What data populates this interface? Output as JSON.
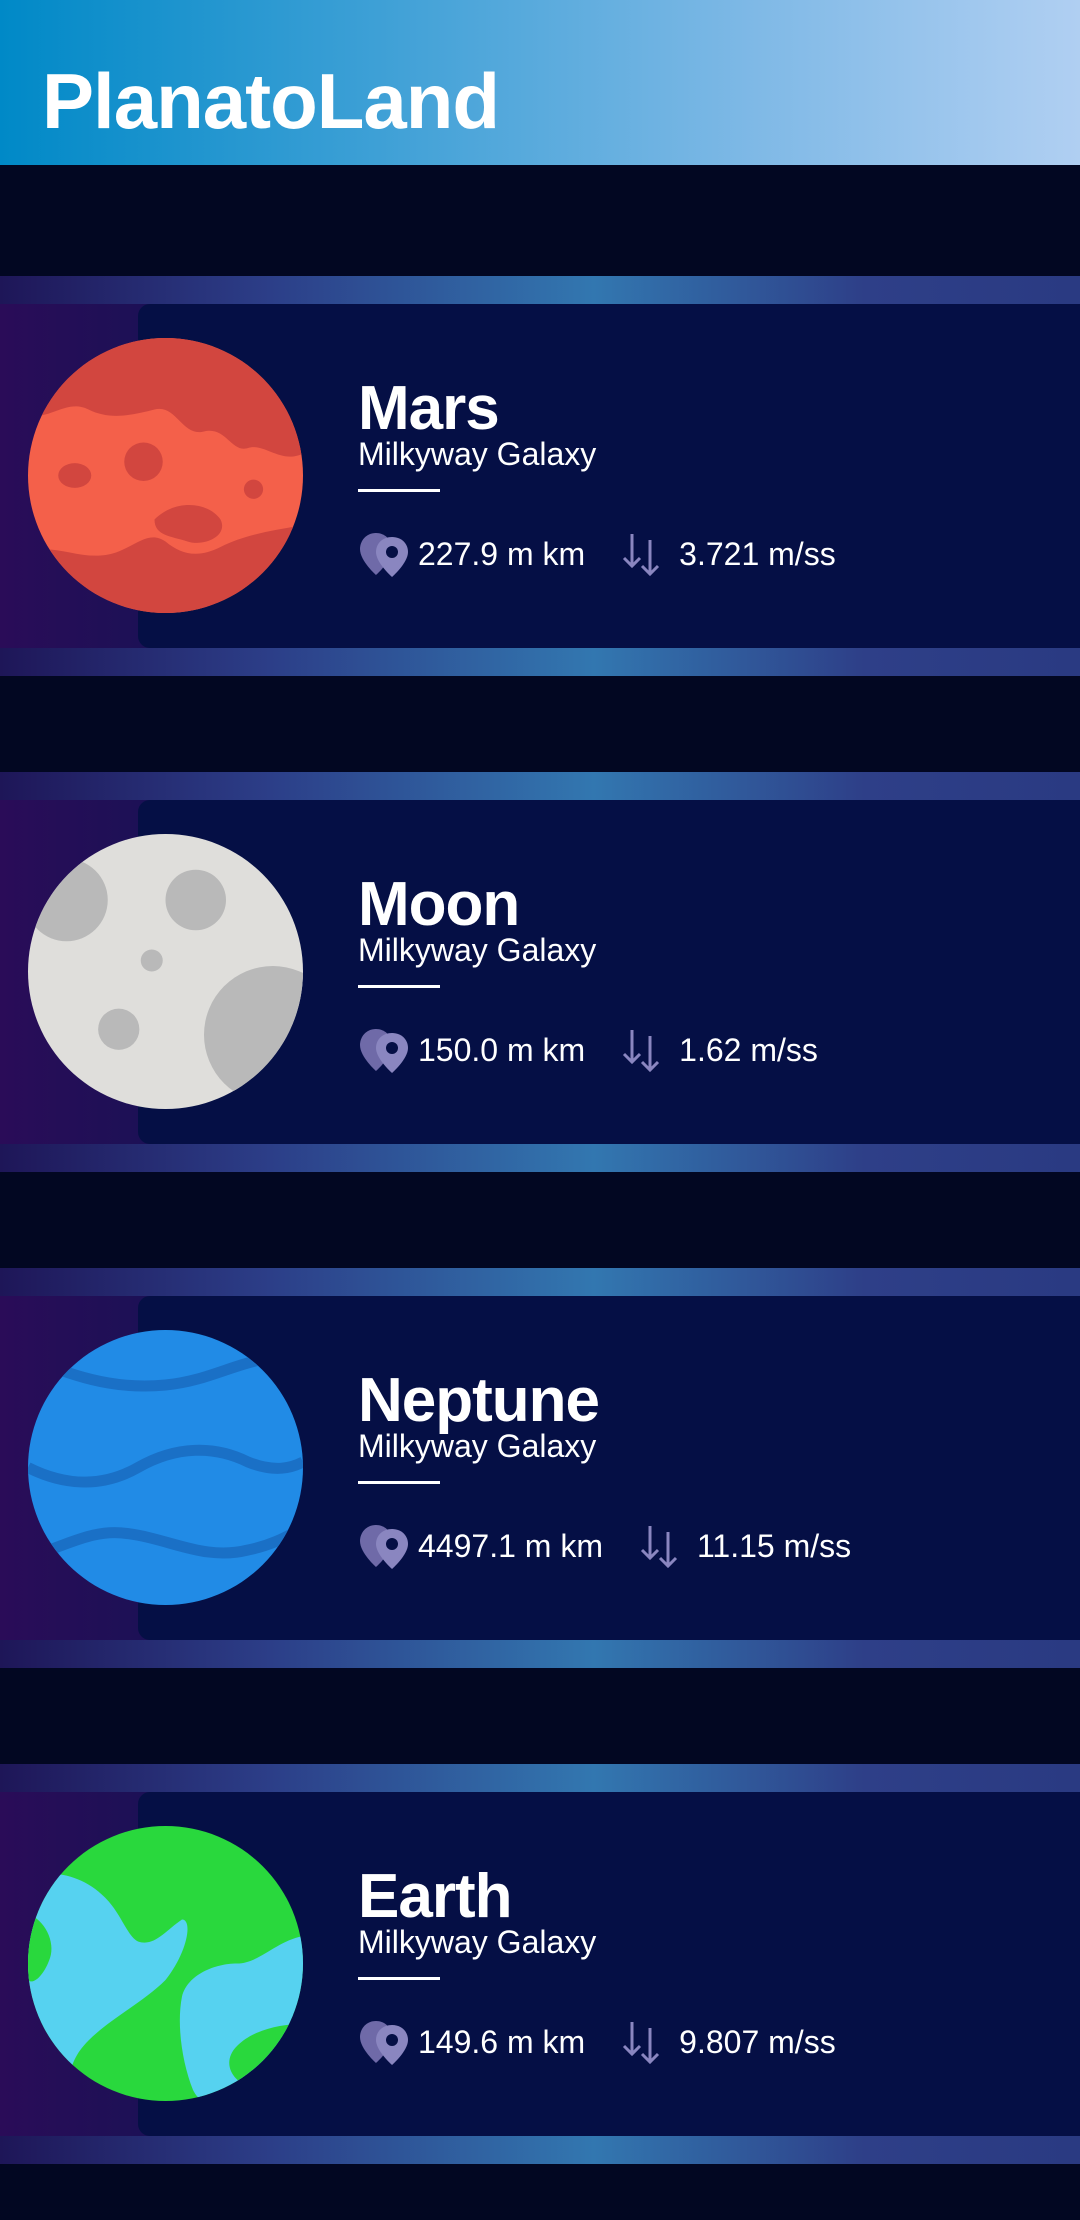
{
  "app": {
    "title": "PlanatoLand"
  },
  "planets": [
    {
      "name": "Mars",
      "galaxy": "Milkyway Galaxy",
      "distance": "227.9 m km",
      "gravity": "3.721 m/ss",
      "icon": "mars-planet-icon"
    },
    {
      "name": "Moon",
      "galaxy": "Milkyway Galaxy",
      "distance": "150.0 m km",
      "gravity": "1.62 m/ss",
      "icon": "moon-planet-icon"
    },
    {
      "name": "Neptune",
      "galaxy": "Milkyway Galaxy",
      "distance": "4497.1 m km",
      "gravity": "11.15 m/ss",
      "icon": "neptune-planet-icon"
    },
    {
      "name": "Earth",
      "galaxy": "Milkyway Galaxy",
      "distance": "149.6 m km",
      "gravity": "9.807 m/ss",
      "icon": "earth-planet-icon"
    }
  ],
  "icons": {
    "distance": "location-pin-icon",
    "gravity": "gravity-arrows-icon"
  },
  "colors": {
    "app_bar_start": "#0089c7",
    "app_bar_end": "#b0cff2",
    "background": "#020722",
    "card_panel": "#050f45",
    "icon_tint": "#8a86c0",
    "text": "#ffffff"
  }
}
